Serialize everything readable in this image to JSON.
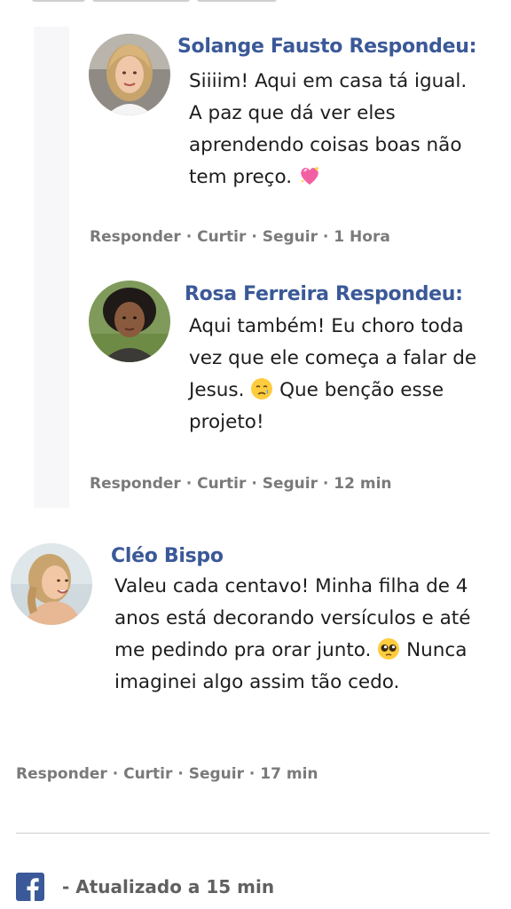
{
  "comments": [
    {
      "name": "Solange Fausto Respondeu:",
      "text": "Siiiim! Aqui em casa tá igual. A paz que dá ver eles aprendendo coisas boas não tem preço.",
      "emoji": "sparkling-heart",
      "actions": {
        "reply": "Responder",
        "like": "Curtir",
        "follow": "Seguir",
        "time": "1 Hora",
        "sep": "·"
      }
    },
    {
      "name": "Rosa Ferreira Respondeu:",
      "text_before": "Aqui também! Eu choro toda vez que ele começa a falar de Jesus.",
      "text_after": "Que benção esse projeto!",
      "emoji": "crying-face",
      "actions": {
        "reply": "Responder",
        "like": "Curtir",
        "follow": "Seguir",
        "time": "12 min",
        "sep": "·"
      }
    },
    {
      "name": "Cléo Bispo",
      "text_before": "Valeu cada centavo! Minha filha de 4 anos está decorando versículos e até me pedindo pra orar junto.",
      "text_after": "Nunca imaginei algo assim tão cedo.",
      "emoji": "pleading-face",
      "actions": {
        "reply": "Responder",
        "like": "Curtir",
        "follow": "Seguir",
        "time": "17 min",
        "sep": "·"
      }
    }
  ],
  "footer": {
    "icon": "facebook-icon",
    "text": "- Atualizado a 15 min"
  },
  "colors": {
    "name": "#3b5998",
    "action": "#7a7a7a",
    "facebook": "#3b5998"
  }
}
